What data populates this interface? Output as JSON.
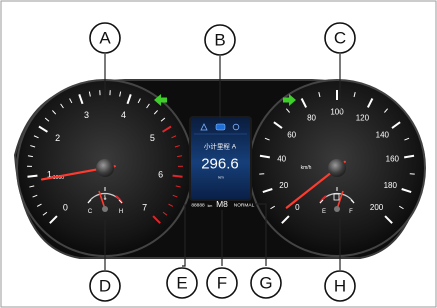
{
  "callouts": [
    "A",
    "B",
    "C",
    "D",
    "E",
    "F",
    "G",
    "H"
  ],
  "tachometer": {
    "labels": [
      "0",
      "1",
      "2",
      "3",
      "4",
      "5",
      "6",
      "7"
    ],
    "unit": "×1000",
    "value": 0.9
  },
  "speedometer": {
    "labels": [
      "0",
      "20",
      "40",
      "60",
      "80",
      "100",
      "120",
      "140",
      "160",
      "180",
      "200"
    ],
    "unit": "km/h",
    "value": 5
  },
  "temp_gauge": {
    "low": "C",
    "high": "H"
  },
  "fuel_gauge": {
    "low": "E",
    "high": "F"
  },
  "display": {
    "trip_label": "小计里程 A",
    "trip_value": "296.6",
    "trip_unit": "km",
    "odometer": "88888",
    "odometer_unit": "km",
    "gear": "M8",
    "drive_mode": "NORMAL"
  },
  "colors": {
    "turn_signal": "#3fcf2a",
    "redline": "#e0262b",
    "needle": "#ff3b2f",
    "screen_accent": "#1e6fd9"
  }
}
